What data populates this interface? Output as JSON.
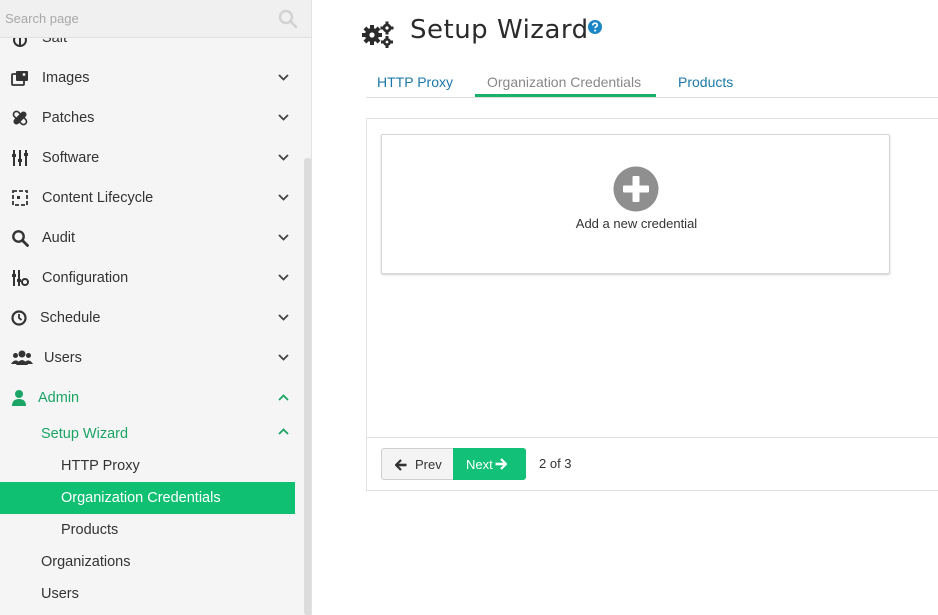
{
  "search": {
    "placeholder": "Search page"
  },
  "sidebar": {
    "items": [
      {
        "label": "Salt",
        "icon": "salt-icon"
      },
      {
        "label": "Images",
        "icon": "images-icon"
      },
      {
        "label": "Patches",
        "icon": "patches-icon"
      },
      {
        "label": "Software",
        "icon": "software-icon"
      },
      {
        "label": "Content Lifecycle",
        "icon": "content-lifecycle-icon"
      },
      {
        "label": "Audit",
        "icon": "audit-search-icon"
      },
      {
        "label": "Configuration",
        "icon": "configuration-icon"
      },
      {
        "label": "Schedule",
        "icon": "clock-icon"
      },
      {
        "label": "Users",
        "icon": "users-icon"
      },
      {
        "label": "Admin",
        "icon": "user-icon"
      }
    ],
    "admin_sub": {
      "setup_wizard": "Setup Wizard",
      "http_proxy": "HTTP Proxy",
      "organization_credentials": "Organization Credentials",
      "products": "Products",
      "organizations": "Organizations",
      "users": "Users"
    }
  },
  "header": {
    "title": "Setup Wizard"
  },
  "tabs": [
    {
      "label": "HTTP Proxy"
    },
    {
      "label": "Organization Credentials"
    },
    {
      "label": "Products"
    }
  ],
  "card": {
    "add_label": "Add a new credential"
  },
  "footer": {
    "prev_label": "Prev",
    "next_label": "Next",
    "pager": "2 of 3"
  },
  "colors": {
    "accent": "#12c177",
    "link": "#1b78a8",
    "active_text": "#1aa566"
  }
}
